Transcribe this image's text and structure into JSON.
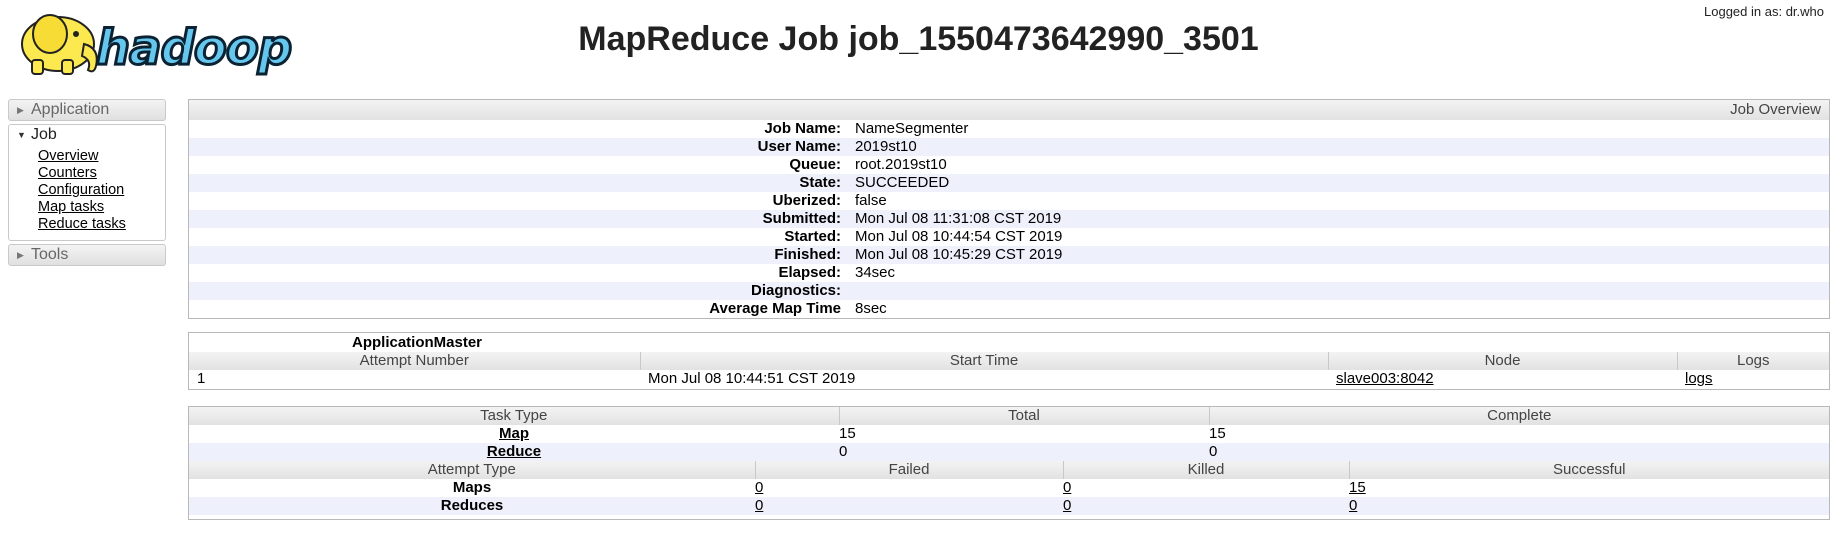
{
  "header": {
    "logo_text": "hadoop",
    "title": "MapReduce Job job_1550473642990_3501",
    "login": "Logged in as: dr.who"
  },
  "nav": {
    "application": "Application",
    "job": "Job",
    "job_links": [
      "Overview",
      "Counters",
      "Configuration",
      "Map tasks",
      "Reduce tasks"
    ],
    "tools": "Tools"
  },
  "overview": {
    "caption": "Job Overview",
    "rows": [
      {
        "key": "Job Name:",
        "value": "NameSegmenter"
      },
      {
        "key": "User Name:",
        "value": "2019st10"
      },
      {
        "key": "Queue:",
        "value": "root.2019st10"
      },
      {
        "key": "State:",
        "value": "SUCCEEDED"
      },
      {
        "key": "Uberized:",
        "value": "false"
      },
      {
        "key": "Submitted:",
        "value": "Mon Jul 08 11:31:08 CST 2019"
      },
      {
        "key": "Started:",
        "value": "Mon Jul 08 10:44:54 CST 2019"
      },
      {
        "key": "Finished:",
        "value": "Mon Jul 08 10:45:29 CST 2019"
      },
      {
        "key": "Elapsed:",
        "value": "34sec"
      },
      {
        "key": "Diagnostics:",
        "value": ""
      },
      {
        "key": "Average Map Time",
        "value": "8sec"
      }
    ]
  },
  "app_master": {
    "title": "ApplicationMaster",
    "headers": [
      "Attempt Number",
      "Start Time",
      "Node",
      "Logs"
    ],
    "row": {
      "attempt": "1",
      "start": "Mon Jul 08 10:44:51 CST 2019",
      "node": "slave003:8042",
      "logs": "logs"
    }
  },
  "tasks": {
    "headers": [
      "Task Type",
      "Total",
      "Complete"
    ],
    "rows": [
      {
        "type": "Map",
        "total": "15",
        "complete": "15"
      },
      {
        "type": "Reduce",
        "total": "0",
        "complete": "0"
      }
    ]
  },
  "attempts": {
    "headers": [
      "Attempt Type",
      "Failed",
      "Killed",
      "Successful"
    ],
    "rows": [
      {
        "type": "Maps",
        "failed": "0",
        "killed": "0",
        "successful": "15"
      },
      {
        "type": "Reduces",
        "failed": "0",
        "killed": "0",
        "successful": "0"
      }
    ]
  }
}
